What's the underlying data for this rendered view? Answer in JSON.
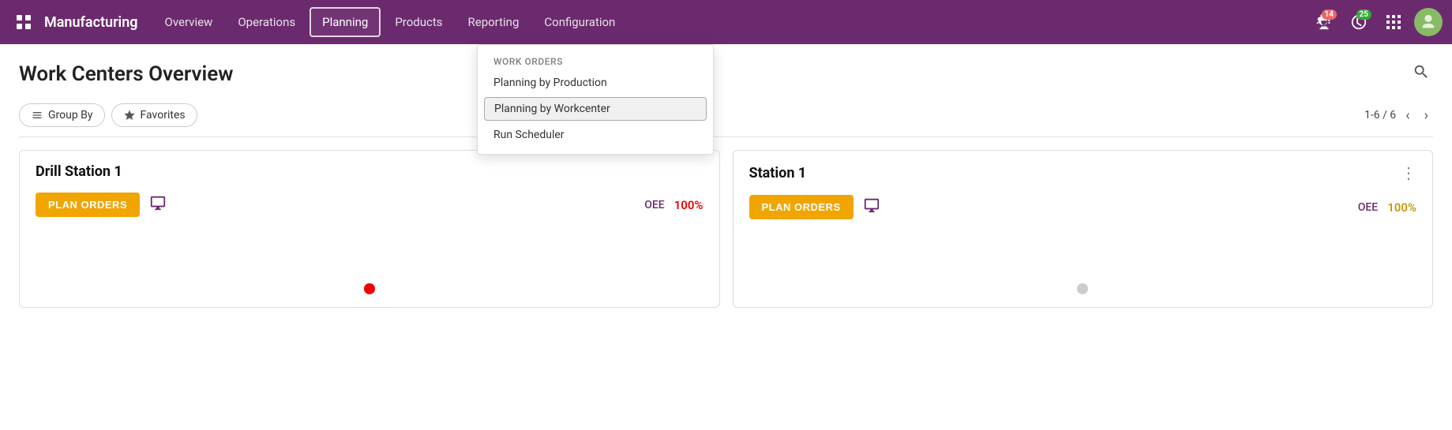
{
  "app": {
    "name": "Manufacturing"
  },
  "nav": {
    "items": [
      {
        "label": "Overview",
        "active": false
      },
      {
        "label": "Operations",
        "active": false
      },
      {
        "label": "Planning",
        "active": true
      },
      {
        "label": "Products",
        "active": false
      },
      {
        "label": "Reporting",
        "active": false
      },
      {
        "label": "Configuration",
        "active": false
      }
    ],
    "badges": {
      "bug_count": "14",
      "clock_count": "25"
    }
  },
  "dropdown": {
    "section_label": "Work Orders",
    "items": [
      {
        "label": "Planning by Production",
        "selected": false
      },
      {
        "label": "Planning by Workcenter",
        "selected": true
      },
      {
        "label": "Run Scheduler",
        "selected": false
      }
    ]
  },
  "page": {
    "title": "Work Centers Overview",
    "search_placeholder": "Search..."
  },
  "filter_bar": {
    "group_by_label": "Group By",
    "favorites_label": "Favorites",
    "pagination": "1-6 / 6"
  },
  "cards": [
    {
      "title": "Drill Station 1",
      "plan_orders_label": "PLAN ORDERS",
      "oee_label": "OEE",
      "oee_value": "100%",
      "oee_color": "red",
      "dot": "red"
    },
    {
      "title": "Station 1",
      "plan_orders_label": "PLAN ORDERS",
      "oee_label": "OEE",
      "oee_value": "100%",
      "oee_color": "gold",
      "dot": "grey"
    }
  ]
}
